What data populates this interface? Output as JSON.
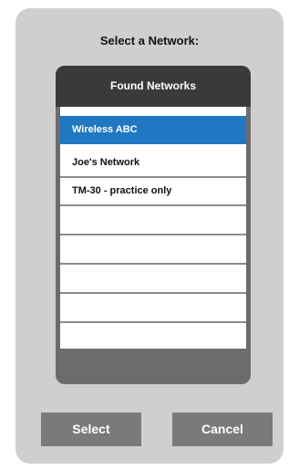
{
  "dialog": {
    "title": "Select a Network:"
  },
  "panel": {
    "header": "Found Networks",
    "networks": [
      {
        "name": "Wireless ABC",
        "selected": true
      },
      {
        "name": "Joe's Network",
        "selected": false
      },
      {
        "name": "TM-30 - practice only",
        "selected": false
      }
    ]
  },
  "buttons": {
    "select_label": "Select",
    "cancel_label": "Cancel"
  },
  "colors": {
    "selected_row": "#1f78c1",
    "header": "#3a3a3a",
    "button": "#7a7a7a"
  }
}
